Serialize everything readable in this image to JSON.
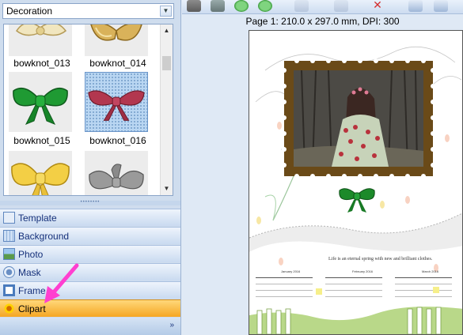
{
  "category": {
    "selected": "Decoration"
  },
  "thumbnails": [
    {
      "label": "bowknot_013"
    },
    {
      "label": "bowknot_014"
    },
    {
      "label": "bowknot_015"
    },
    {
      "label": "bowknot_016",
      "selected": true
    },
    {
      "label": ""
    },
    {
      "label": ""
    }
  ],
  "nav": [
    {
      "label": "Template"
    },
    {
      "label": "Background"
    },
    {
      "label": "Photo"
    },
    {
      "label": "Mask"
    },
    {
      "label": "Frame"
    },
    {
      "label": "Clipart",
      "active": true
    }
  ],
  "page_info": "Page 1: 210.0 x 297.0 mm, DPI: 300",
  "canvas": {
    "quote": "Life is an eternal spring with new and brilliant clothes.",
    "months": [
      "January  2016",
      "February  2016",
      "March  2016"
    ]
  },
  "colors": {
    "accent": "#f5a623",
    "arrow": "#ff3fd0",
    "stamp": "#6a4a18",
    "bow": "#1c8a2a"
  }
}
